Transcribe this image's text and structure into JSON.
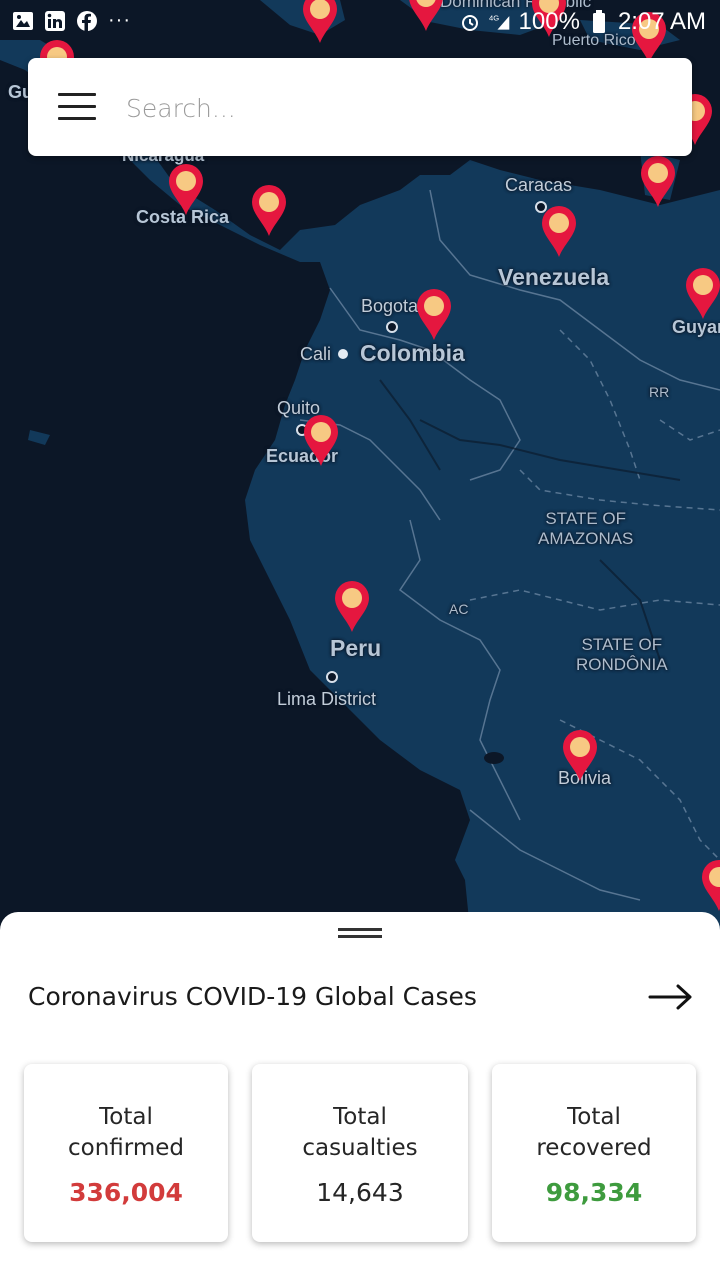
{
  "status_bar": {
    "battery": "100%",
    "time": "2:07 AM",
    "more": "···"
  },
  "search": {
    "placeholder": "Search..."
  },
  "map": {
    "labels": {
      "nicaragua": "Nicaragua",
      "costa_rica": "Costa Rica",
      "gu": "Gu",
      "dominican_republic": "Dominican Republic",
      "puerto_rico": "Puerto Rico",
      "caracas": "Caracas",
      "venezuela": "Venezuela",
      "guyana": "Guyar",
      "bogota": "Bogota",
      "colombia": "Colombia",
      "cali": "Cali",
      "rr": "RR",
      "quito": "Quito",
      "ecuador": "Ecuador",
      "amazonas_1": "STATE OF",
      "amazonas_2": "AMAZONAS",
      "ac": "AC",
      "peru": "Peru",
      "rondonia_1": "STATE OF",
      "rondonia_2": "RONDÔNIA",
      "lima": "Lima District",
      "bolivia": "Bolivia"
    },
    "colors": {
      "land": "#12395a",
      "water": "#0c1727",
      "pin": "#e5173f",
      "pin_dot": "#f7c983"
    }
  },
  "sheet": {
    "title": "Coronavirus COVID-19 Global Cases",
    "stats": [
      {
        "label_1": "Total",
        "label_2": "confirmed",
        "value": "336,004",
        "color": "#d23b3b"
      },
      {
        "label_1": "Total",
        "label_2": "casualties",
        "value": "14,643",
        "color": "#262626"
      },
      {
        "label_1": "Total",
        "label_2": "recovered",
        "value": "98,334",
        "color": "#3e9b3e"
      }
    ]
  }
}
